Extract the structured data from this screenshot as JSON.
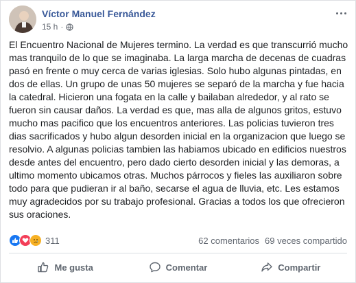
{
  "post": {
    "author": "Víctor Manuel Fernández",
    "time": "15 h",
    "meta_separator": "·",
    "text": "El Encuentro Nacional de Mujeres termino. La verdad es que transcurrió mucho mas tranquilo de lo que se imaginaba. La larga marcha de decenas de cuadras pasó en frente o muy cerca de varias iglesias. Solo hubo algunas pintadas, en dos de ellas. Un grupo de unas 50 mujeres se separó de la marcha y fue hacia la catedral. Hicieron una fogata en la calle y bailaban alrededor, y al rato se fueron sin causar daños. La verdad es que, mas alla de algunos gritos, estuvo mucho mas pacifico que los encuentros anteriores. Las policias tuvieron tres dias sacrificados y hubo algun desorden inicial en la organizacion que luego se resolvio. A algunas policias tambien las habiamos ubicado en edificios nuestros desde antes del encuentro, pero dado cierto desorden inicial y las demoras, a ultimo momento ubicamos otras. Muchos párrocos y fieles las auxiliaron sobre todo para que pudieran ir al baño, secarse el agua de lluvia, etc. Les estamos muy agradecidos por su trabajo profesional. Gracias a todos los que ofrecieron sus oraciones."
  },
  "reactions": {
    "icons": [
      "like-icon",
      "love-icon",
      "sad-icon"
    ],
    "count": "311",
    "comments": "62 comentarios",
    "shares": "69 veces compartido"
  },
  "actions": {
    "like": "Me gusta",
    "comment": "Comentar",
    "share": "Compartir"
  },
  "colors": {
    "author": "#385898",
    "like": "#1877f2",
    "love": "#f33e58",
    "sad": "#f7b125"
  }
}
